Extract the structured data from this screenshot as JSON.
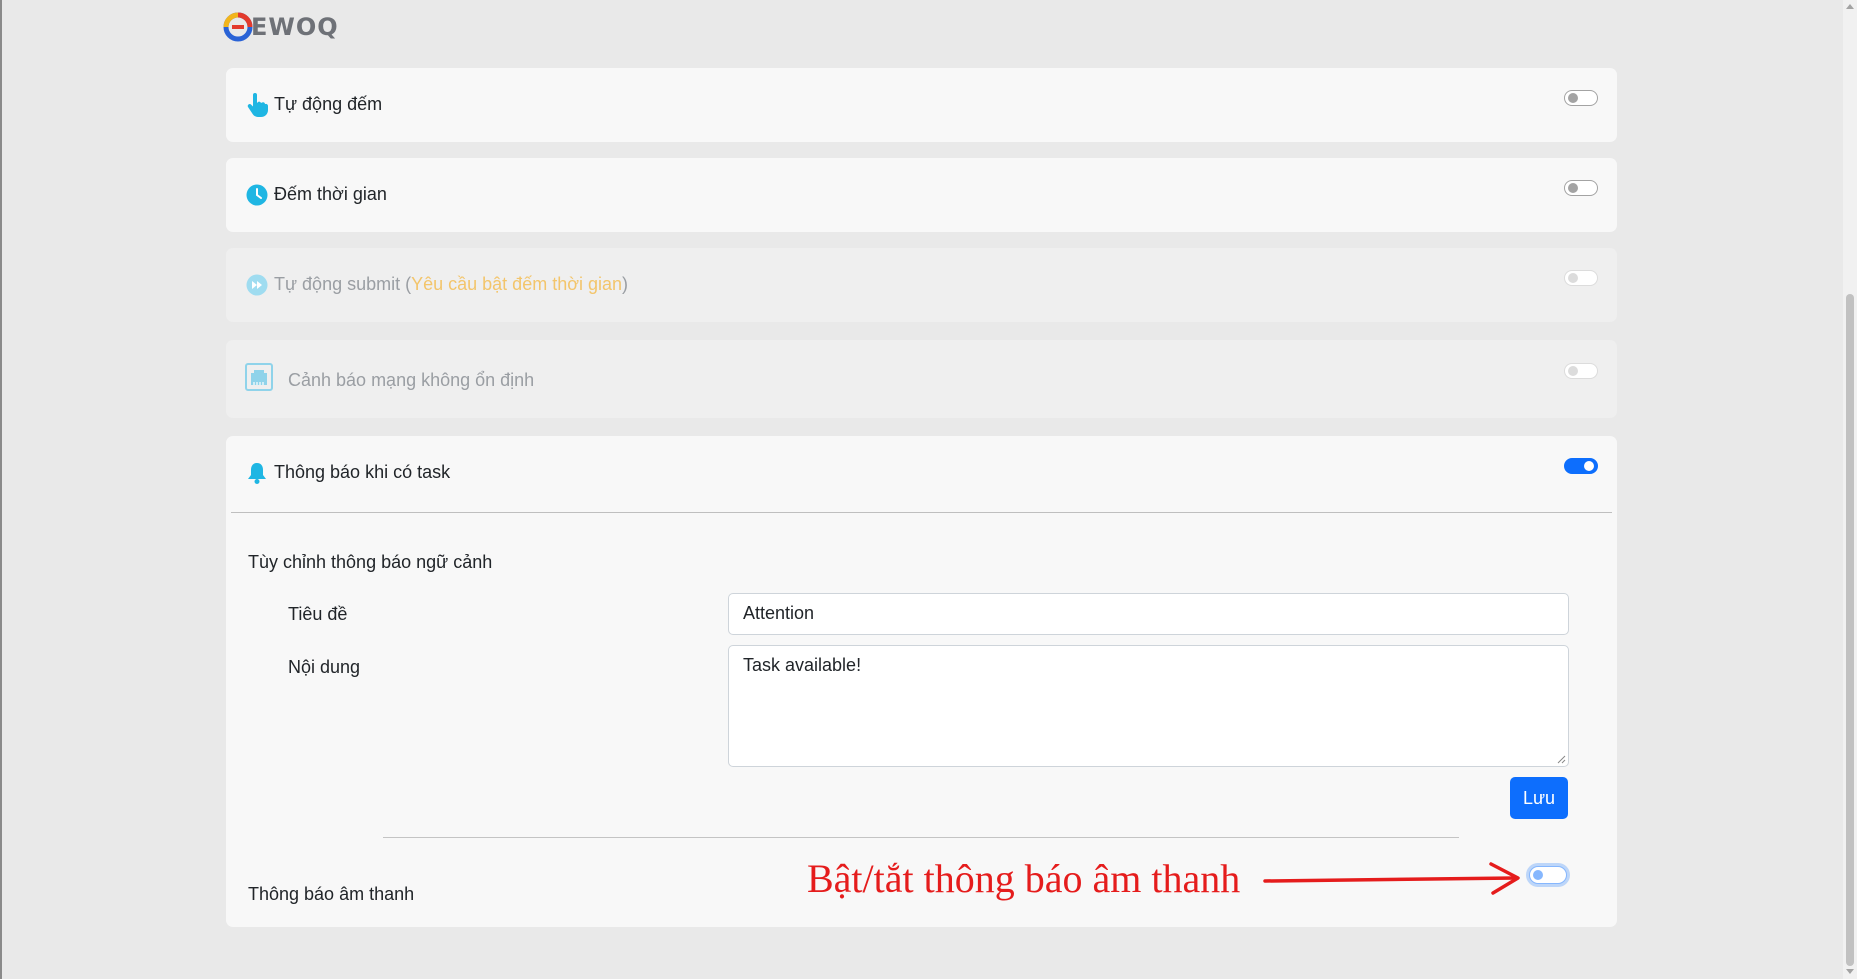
{
  "logo": {
    "text": "EWOQ"
  },
  "settings": [
    {
      "label": "Tự động đếm",
      "enabled": false,
      "disabled": false,
      "icon": "hand-pointer-icon"
    },
    {
      "label": "Đếm thời gian",
      "enabled": false,
      "disabled": false,
      "icon": "clock-icon"
    },
    {
      "label": "Tự động submit (",
      "note": "Yêu cầu bật đếm thời gian",
      "note_suffix": ")",
      "enabled": false,
      "disabled": true,
      "icon": "fast-forward-icon"
    },
    {
      "label": "Cảnh báo mạng không ổn định",
      "enabled": false,
      "disabled": true,
      "icon": "network-port-icon"
    },
    {
      "label": "Thông báo khi có task",
      "enabled": true,
      "disabled": false,
      "icon": "bell-icon"
    }
  ],
  "notification": {
    "section_title": "Tùy chỉnh thông báo ngữ cảnh",
    "title_label": "Tiêu đề",
    "title_value": "Attention",
    "content_label": "Nội dung",
    "content_value": "Task available!",
    "save_label": "Lưu",
    "sound_label": "Thông báo âm thanh",
    "sound_enabled": false
  },
  "annotation": {
    "text": "Bật/tắt thông báo âm thanh",
    "color": "#e51c1c"
  },
  "colors": {
    "accent": "#0d6efd",
    "icon": "#1fb6e3",
    "note": "#f3c56b"
  }
}
